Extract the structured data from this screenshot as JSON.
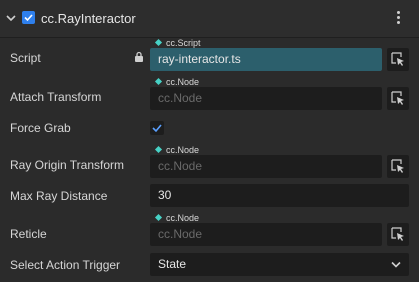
{
  "component": {
    "title": "cc.RayInteractor",
    "enabled": true
  },
  "rows": {
    "script": {
      "label": "Script",
      "type_tag": "cc.Script",
      "value": "ray-interactor.ts"
    },
    "attach_transform": {
      "label": "Attach Transform",
      "type_tag": "cc.Node",
      "placeholder": "cc.Node"
    },
    "force_grab": {
      "label": "Force Grab",
      "checked": true
    },
    "ray_origin_transform": {
      "label": "Ray Origin Transform",
      "type_tag": "cc.Node",
      "placeholder": "cc.Node"
    },
    "max_ray_distance": {
      "label": "Max Ray Distance",
      "value": "30"
    },
    "reticle": {
      "label": "Reticle",
      "type_tag": "cc.Node",
      "placeholder": "cc.Node"
    },
    "select_action_trigger": {
      "label": "Select Action Trigger",
      "value": "State"
    }
  },
  "icons": {
    "collapse": "chevron-down-icon",
    "enabled_checkbox": "checkbox-checked-icon",
    "menu": "kebab-menu-icon",
    "lock": "lock-icon",
    "type_tag": "diamond-icon",
    "picker": "pick-target-icon",
    "dropdown": "chevron-down-icon"
  },
  "colors": {
    "accent": "#2f80ed",
    "type_tag": "#47d2c6",
    "script_field": "#2c5f6c"
  }
}
